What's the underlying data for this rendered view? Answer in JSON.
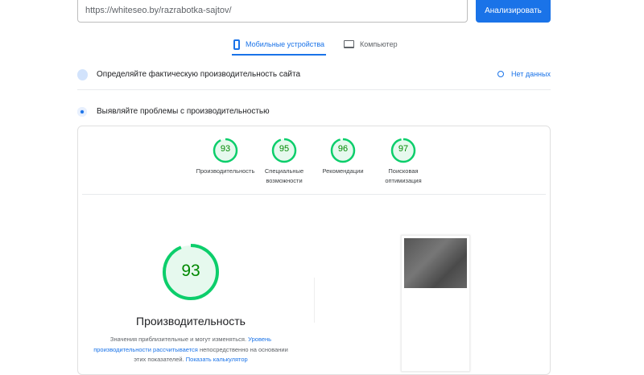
{
  "search": {
    "url": "https://whiteseo.by/razrabotka-sajtov/",
    "button": "Анализировать"
  },
  "tabs": [
    {
      "label": "Мобильные устройства",
      "active": true
    },
    {
      "label": "Компьютер",
      "active": false
    }
  ],
  "field": {
    "title": "Определяйте фактическую производительность сайта",
    "status": "Нет данных"
  },
  "lab": {
    "title": "Выявляйте проблемы с производительностью"
  },
  "scores": [
    {
      "value": "93",
      "label1": "Производительность",
      "label2": ""
    },
    {
      "value": "95",
      "label1": "Специальные",
      "label2": "возможности"
    },
    {
      "value": "96",
      "label1": "Рекомендации",
      "label2": ""
    },
    {
      "value": "97",
      "label1": "Поисковая",
      "label2": "оптимизация"
    }
  ],
  "main": {
    "score": "93",
    "title": "Производительность",
    "desc1": "Значения приблизительные и могут изменяться. ",
    "link1": "Уровень производительности рассчитывается",
    "desc2": " непосредственно на основании этих показателей. ",
    "link2": "Показать калькулятор"
  },
  "colors": {
    "accent": "#1a73e8",
    "pass": "#0cce6b",
    "pass_text": "#008800",
    "pass_fill": "#e6f9ee"
  }
}
